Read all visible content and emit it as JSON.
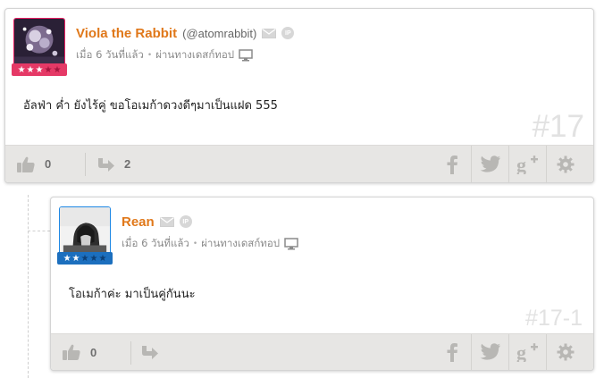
{
  "comments": [
    {
      "author_name": "Viola the Rabbit",
      "author_handle": "(@atomrabbit)",
      "time_ago": "เมื่อ 6 วันที่แล้ว",
      "via": "ผ่านทางเดสก์ทอป",
      "body": "อัลฟ่า ค่ำ ยังไร้คู่ ขอโอเมก้าดวงดีๆมาเป็นแฝด 555",
      "number": "#17",
      "likes": "0",
      "shares": "2",
      "rank_stars": 3,
      "rank_total": 5,
      "rank_color": "#e53966"
    },
    {
      "author_name": "Rean",
      "time_ago": "เมื่อ 6 วันที่แล้ว",
      "via": "ผ่านทางเดสก์ทอป",
      "body": "โอเมก้าค่ะ มาเป็นคู่กันนะ",
      "number": "#17-1",
      "likes": "0",
      "rank_stars": 2,
      "rank_total": 5,
      "rank_color": "#1c6fbe"
    }
  ],
  "icons": {
    "like": "thumbs-up-icon",
    "share": "share-arrow-icon",
    "mail": "envelope-icon",
    "ip": "ip-badge-icon",
    "device": "desktop-monitor-icon",
    "facebook": "facebook-icon",
    "twitter": "twitter-icon",
    "googleplus": "google-plus-icon",
    "settings": "gear-icon"
  },
  "ip_badge_text": "IP",
  "colors": {
    "author_name": "#e0781a",
    "footer_bg": "#e7e6e4",
    "icon_gray": "#b8b7b4",
    "comment_number": "#e2e2e2"
  }
}
